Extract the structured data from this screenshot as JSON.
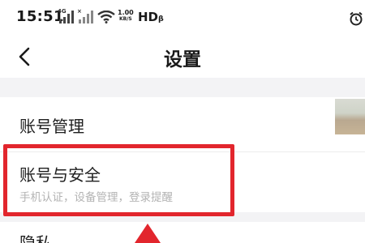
{
  "status_bar": {
    "time": "15:51",
    "net1": "4G",
    "net2": "×",
    "speed_value": "1.00",
    "speed_unit": "KB/S",
    "hd": "HDᵦ",
    "icon_signal": "signal-icon",
    "icon_wifi": "wifi-icon",
    "icon_alarm": "alarm-icon"
  },
  "header": {
    "title": "设置",
    "back_icon": "chevron-left-icon"
  },
  "settings": {
    "account_management": "账号管理",
    "account_security": "账号与安全",
    "account_security_sub": "手机认证，设备管理，登录提醒",
    "privacy": "隐私"
  },
  "colors": {
    "highlight": "#e2262d",
    "separator": "#f3f3f5",
    "subtitle": "#b3b3b3"
  }
}
